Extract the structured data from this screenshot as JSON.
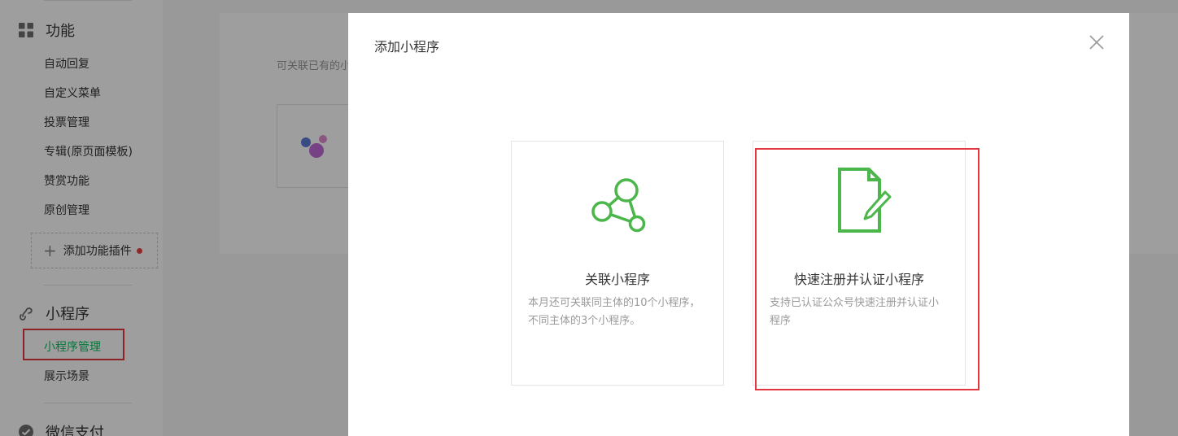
{
  "sidebar": {
    "features": {
      "title": "功能",
      "icon": "grid-icon",
      "items": [
        {
          "label": "自动回复"
        },
        {
          "label": "自定义菜单"
        },
        {
          "label": "投票管理"
        },
        {
          "label": "专辑(原页面模板)"
        },
        {
          "label": "赞赏功能"
        },
        {
          "label": "原创管理"
        }
      ],
      "add_plugin_label": "添加功能插件"
    },
    "miniprogram": {
      "title": "小程序",
      "icon": "miniprogram-icon",
      "items": [
        {
          "label": "小程序管理",
          "active": true
        },
        {
          "label": "展示场景"
        }
      ]
    },
    "wechat_pay": {
      "title": "微信支付",
      "icon": "check-circle-icon"
    }
  },
  "main": {
    "description_prefix": "可关联已有的小"
  },
  "modal": {
    "title": "添加小程序",
    "options": [
      {
        "icon": "link-graph-icon",
        "title": "关联小程序",
        "description": "本月还可关联同主体的10个小程序，不同主体的3个小程序。"
      },
      {
        "icon": "document-edit-icon",
        "title": "快速注册并认证小程序",
        "description": "支持已认证公众号快速注册并认证小程序"
      }
    ]
  },
  "colors": {
    "accent_green": "#07c160",
    "icon_green": "#4bb64a",
    "highlight_red": "#e3373d",
    "notification_dot": "#e64340"
  }
}
